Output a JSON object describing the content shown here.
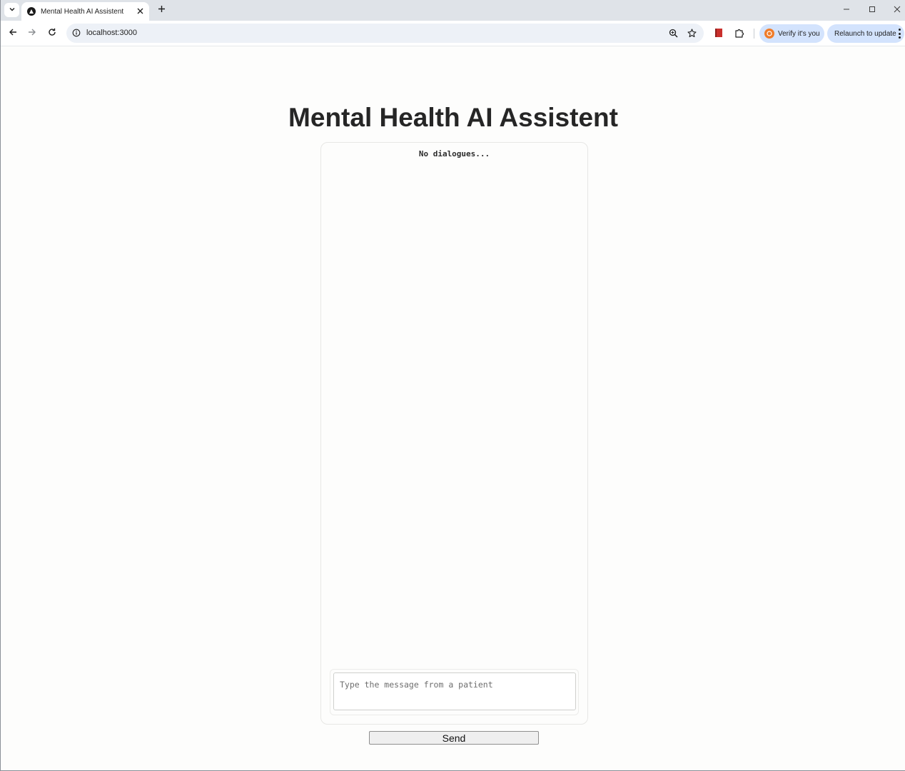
{
  "browser": {
    "tab_title": "Mental Health AI Assistent",
    "url": "localhost:3000",
    "verify_chip_label": "Verify it's you",
    "relaunch_label": "Relaunch to update"
  },
  "page": {
    "title": "Mental Health AI Assistent",
    "empty_state": "No dialogues...",
    "input_placeholder": "Type the message from a patient",
    "send_label": "Send"
  },
  "icons": {
    "tab_search": "chevron-down-icon",
    "favicon": "triangle-logo-icon",
    "close_tab": "close-icon",
    "new_tab": "plus-icon",
    "back": "arrow-left-icon",
    "forward": "arrow-right-icon",
    "reload": "reload-icon",
    "site_info": "info-icon",
    "zoom": "zoom-icon",
    "bookmark": "star-icon",
    "extension_red": "book-extension-icon",
    "extensions": "puzzle-icon",
    "menu": "more-vert-icon"
  },
  "colors": {
    "tabstrip": "#dfe3e8",
    "omnibox": "#edf1f7",
    "chip": "#d3e3fd",
    "page_bg": "#fdfdfc",
    "title_text": "#262626"
  }
}
